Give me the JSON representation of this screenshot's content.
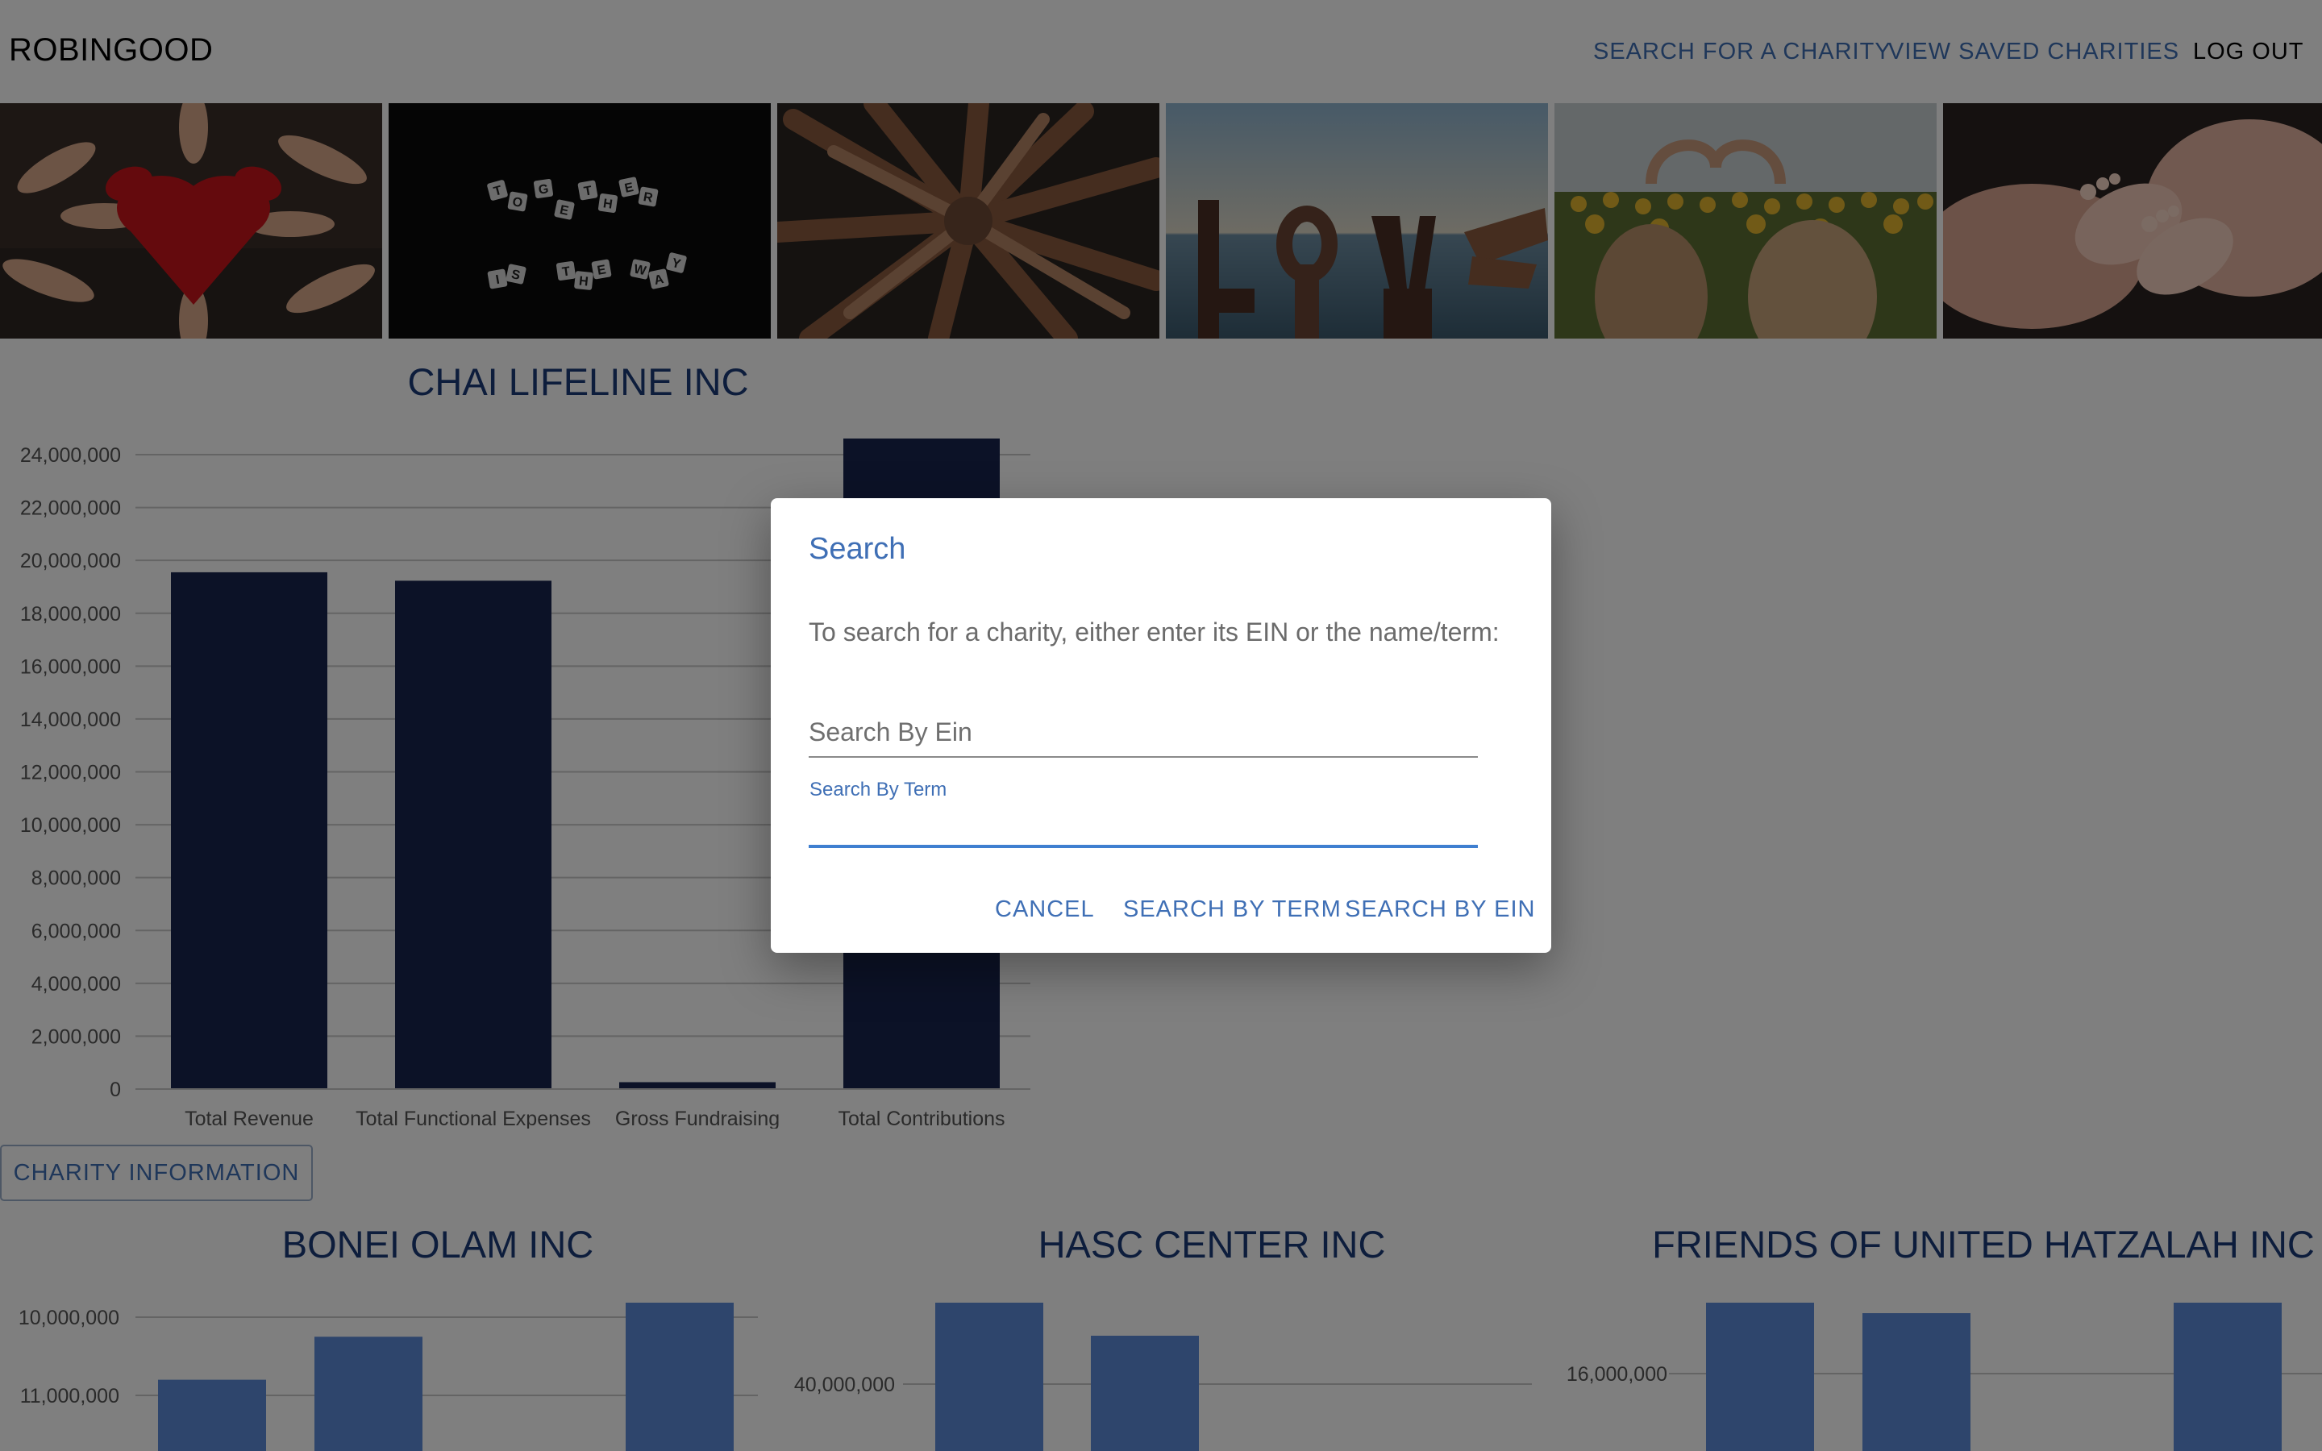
{
  "navbar": {
    "brand": "ROBINGOOD",
    "links": {
      "search": "SEARCH FOR A CHARITY",
      "saved": "VIEW SAVED CHARITIES",
      "logout": "LOG OUT"
    }
  },
  "gallery": {
    "photos": [
      {
        "name": "red-heart-hands-photo",
        "letters_top": "",
        "letters_bottom": ""
      },
      {
        "name": "together-is-the-way-photo",
        "letters_top": "TOGETHER",
        "letters_bottom": "IS THE WAY"
      },
      {
        "name": "circle-of-hands-photo"
      },
      {
        "name": "love-hand-signs-photo"
      },
      {
        "name": "sunflower-heart-photo"
      },
      {
        "name": "baby-feet-photo"
      }
    ]
  },
  "main_chart": {
    "title": "CHAI LIFELINE INC"
  },
  "chart_data": [
    {
      "type": "bar",
      "title": "CHAI LIFELINE INC",
      "categories": [
        "Total Revenue",
        "Total Functional Expenses",
        "Gross Fundraising",
        "Total Contributions"
      ],
      "values": [
        19550000,
        19230000,
        260000,
        24650000
      ],
      "ylim": [
        0,
        24000000
      ],
      "yticks": [
        0,
        2000000,
        4000000,
        6000000,
        8000000,
        10000000,
        12000000,
        14000000,
        16000000,
        18000000,
        20000000,
        22000000,
        24000000
      ],
      "ytick_labels": [
        "0",
        "2,000,000",
        "4,000,000",
        "6,000,000",
        "8,000,000",
        "10,000,000",
        "12,000,000",
        "14,000,000",
        "16,000,000",
        "18,000,000",
        "20,000,000",
        "22,000,000",
        "24,000,000"
      ],
      "grid": true,
      "color": "#18244e"
    },
    {
      "type": "bar",
      "title": "BONEI OLAM INC",
      "values": [
        9200000,
        9750000,
        null,
        11200000
      ],
      "yticks": [
        10000000,
        11000000
      ],
      "ytick_labels": [
        "10,000,000",
        "11,000,000"
      ],
      "grid": true,
      "color": "#5d8ad9"
    },
    {
      "type": "bar",
      "title": "HASC CENTER INC",
      "values": [
        41700000,
        41000000
      ],
      "yticks": [
        40000000
      ],
      "ytick_labels": [
        "40,000,000"
      ],
      "grid": true,
      "color": "#5d8ad9"
    },
    {
      "type": "bar",
      "title": "FRIENDS OF UNITED HATZALAH INC",
      "values": [
        16300000,
        16250000,
        null,
        16300000
      ],
      "yticks": [
        16000000
      ],
      "ytick_labels": [
        "16,000,000"
      ],
      "grid": true,
      "color": "#5d8ad9"
    }
  ],
  "small_charts": {
    "bonei_title": "BONEI OLAM INC",
    "hasc_title": "HASC CENTER INC",
    "hatzalah_title": "FRIENDS OF UNITED HATZALAH INC"
  },
  "info_button": "CHARITY INFORMATION",
  "dialog": {
    "title": "Search",
    "text": "To search for a charity, either enter its EIN or the name/term:",
    "ein_placeholder": "Search By Ein",
    "term_label": "Search By Term",
    "term_value": "",
    "buttons": {
      "cancel": "CANCEL",
      "by_term": "SEARCH BY TERM",
      "by_ein": "SEARCH BY EIN"
    }
  },
  "colors": {
    "accent": "#3f6fb5",
    "title_blue": "#1b3a78",
    "main_bar": "#18244e",
    "small_bar": "#5d8ad9"
  }
}
